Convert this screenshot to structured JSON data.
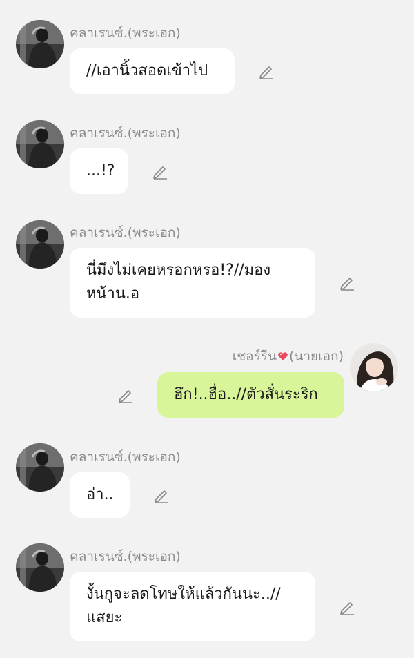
{
  "messages": [
    {
      "sender": "คลาเรนซ์.(พระเอก)",
      "text": "//เอานิ้วสอดเข้าไป",
      "side": "left"
    },
    {
      "sender": "คลาเรนซ์.(พระเอก)",
      "text": "...!?",
      "side": "left"
    },
    {
      "sender": "คลาเรนซ์.(พระเอก)",
      "text": "นี่มึงไม่เคยหรอกหรอ!?//มอง\nหน้าน.อ",
      "side": "left"
    },
    {
      "sender_prefix": "เชอร์รีน",
      "sender_suffix": "(นายเอก)",
      "text": "ฮึก!..ฮื่อ..//ตัวสั่นระริก",
      "side": "right"
    },
    {
      "sender": "คลาเรนซ์.(พระเอก)",
      "text": "อ่า..",
      "side": "left"
    },
    {
      "sender": "คลาเรนซ์.(พระเอก)",
      "text": "งั้นกูจะลดโทษให้แล้วกันนะ..//\nแสยะ",
      "side": "left"
    }
  ],
  "icons": {
    "edit": "pencil-edit-icon",
    "heart": "heart-icon"
  },
  "colors": {
    "background": "#f2f2f2",
    "bubble_other": "#ffffff",
    "bubble_mine": "#d8f59a",
    "sender_text": "#8a8a8a"
  }
}
